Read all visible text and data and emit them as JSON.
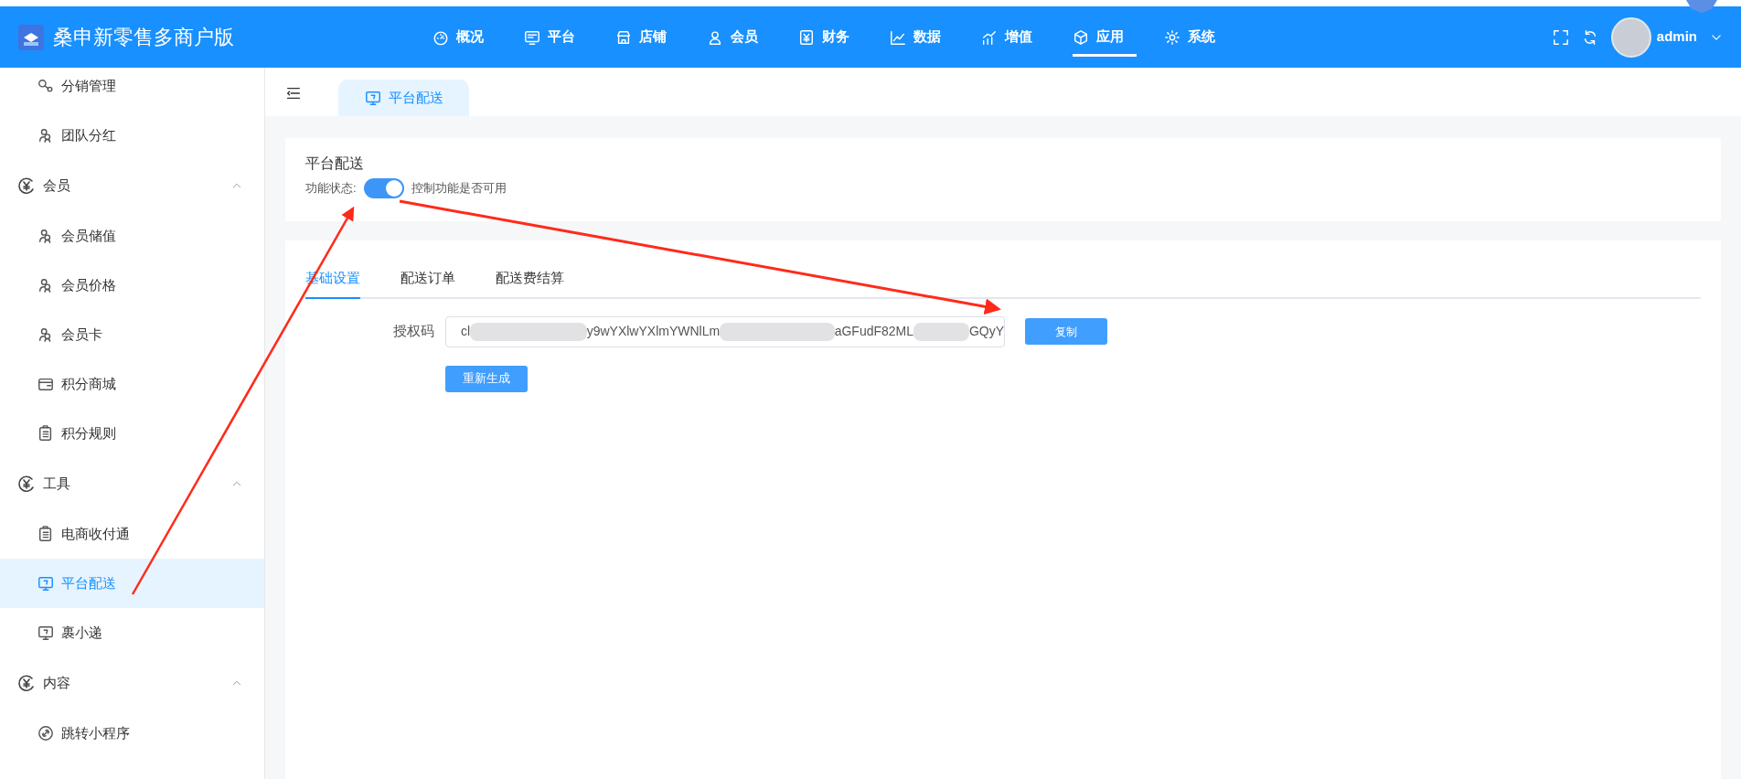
{
  "header": {
    "title": "桑申新零售多商户版",
    "nav": [
      {
        "label": "概况",
        "selected": false
      },
      {
        "label": "平台",
        "selected": false
      },
      {
        "label": "店铺",
        "selected": false
      },
      {
        "label": "会员",
        "selected": false
      },
      {
        "label": "财务",
        "selected": false
      },
      {
        "label": "数据",
        "selected": false
      },
      {
        "label": "增值",
        "selected": false
      },
      {
        "label": "应用",
        "selected": true
      },
      {
        "label": "系统",
        "selected": false
      }
    ],
    "user": "admin"
  },
  "sidebar": {
    "items": [
      {
        "kind": "item",
        "label": "分销管理",
        "selected": false
      },
      {
        "kind": "item",
        "label": "团队分红",
        "selected": false
      },
      {
        "kind": "group",
        "label": "会员",
        "expanded": true,
        "children": [
          {
            "kind": "item",
            "label": "会员储值",
            "selected": false
          },
          {
            "kind": "item",
            "label": "会员价格",
            "selected": false
          },
          {
            "kind": "item",
            "label": "会员卡",
            "selected": false
          },
          {
            "kind": "item",
            "label": "积分商城",
            "selected": false
          },
          {
            "kind": "item",
            "label": "积分规则",
            "selected": false
          }
        ]
      },
      {
        "kind": "group",
        "label": "工具",
        "expanded": true,
        "children": [
          {
            "kind": "item",
            "label": "电商收付通",
            "selected": false
          },
          {
            "kind": "item",
            "label": "平台配送",
            "selected": true
          },
          {
            "kind": "item",
            "label": "裹小递",
            "selected": false
          }
        ]
      },
      {
        "kind": "group",
        "label": "内容",
        "expanded": true,
        "children": [
          {
            "kind": "item",
            "label": "跳转小程序",
            "selected": false
          }
        ]
      }
    ]
  },
  "page_tabs": [
    {
      "label": "平台配送",
      "selected": true
    }
  ],
  "feature": {
    "title": "平台配送",
    "status_label": "功能状态:",
    "on": true,
    "hint": "控制功能是否可用"
  },
  "settings": {
    "tabs": [
      {
        "label": "基础设置",
        "selected": true
      },
      {
        "label": "配送订单",
        "selected": false
      },
      {
        "label": "配送费结算",
        "selected": false
      }
    ],
    "auth_label": "授权码",
    "auth_value_parts": [
      "cl",
      "y9wYXlwYXlmYWNlLm",
      "aGFudF82ML",
      "GQyY"
    ],
    "copy_button": "复制",
    "regenerate_button": "重新生成"
  }
}
